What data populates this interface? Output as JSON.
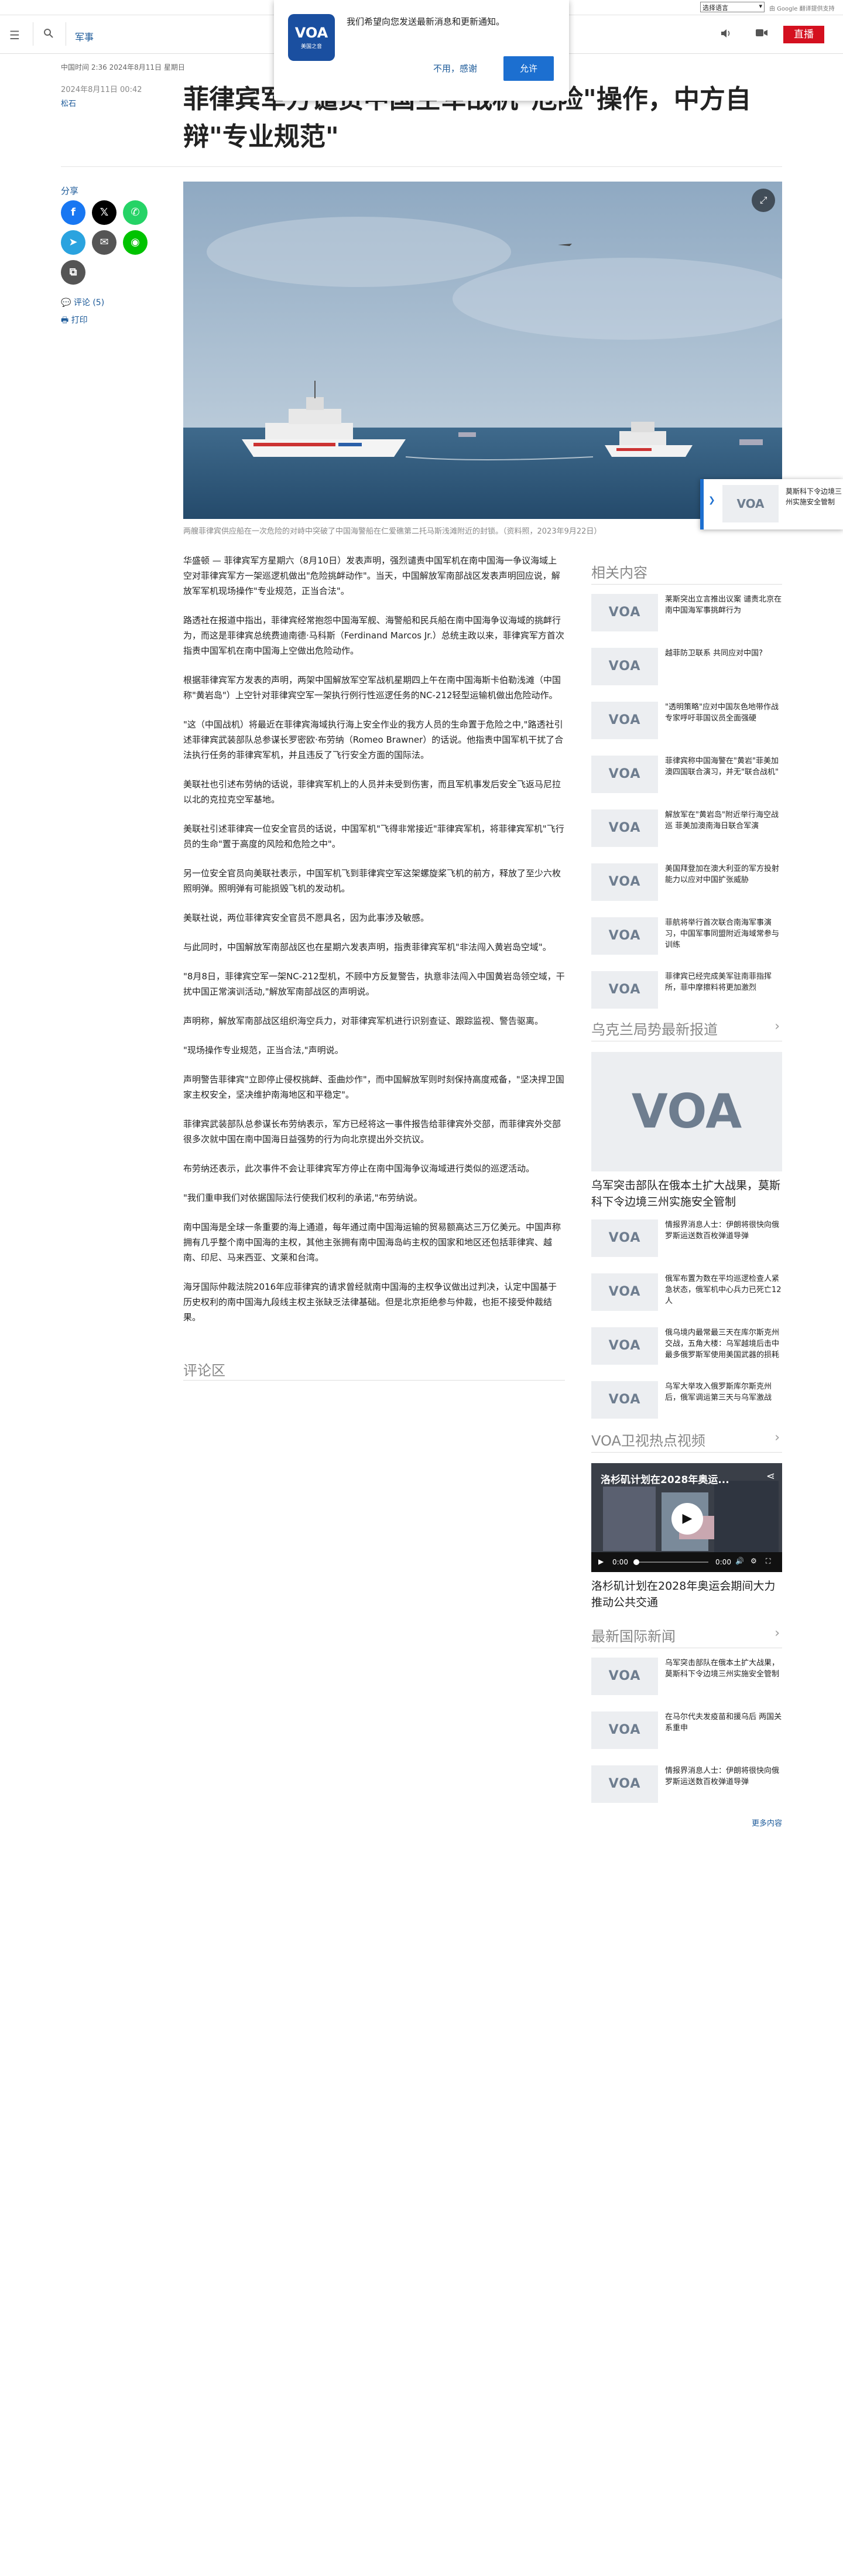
{
  "translate": {
    "select_label": "选择语言",
    "powered_by": "由 Google 翻译提供支持",
    "powered_google": "Google",
    "powered_translate": "翻译"
  },
  "header": {
    "section": "军事",
    "live_label": "直播"
  },
  "notification": {
    "message": "我们希望向您发送最新消息和更新通知。",
    "decline": "不用，感谢",
    "allow": "允许",
    "logo_sub": "美国之音"
  },
  "article_meta": {
    "dateline": "中国时间 2:36 2024年8月11日 星期日",
    "published": "2024年8月11日 00:42",
    "author": "松石"
  },
  "headline": "菲律宾军方谴责中国空军战机\"危险\"操作，中方自辩\"专业规范\"",
  "share": {
    "label": "分享",
    "comments": "评论 (5)",
    "print": "打印"
  },
  "photo": {
    "caption": "两艘菲律宾供应船在一次危险的对峙中突破了中国海警船在仁爱礁第二托马斯浅滩附近的封锁。（资料照，2023年9月22日）"
  },
  "article": {
    "paragraphs": [
      "华盛顿 — 菲律宾军方星期六（8月10日）发表声明，强烈谴责中国军机在南中国海一争议海域上空对菲律宾军方一架巡逻机做出\"危险挑衅动作\"。当天，中国解放军南部战区发表声明回应说，解放军军机现场操作\"专业规范，正当合法\"。",
      "路透社在报道中指出，菲律宾经常抱怨中国海军舰、海警船和民兵船在南中国海争议海域的挑衅行为，而这是菲律宾总统费迪南德·马科斯（Ferdinand Marcos Jr.）总统主政以来，菲律宾军方首次指责中国军机在南中国海上空做出危险动作。",
      "根据菲律宾军方发表的声明，两架中国解放军空军战机星期四上午在南中国海斯卡伯勒浅滩（中国称\"黄岩岛\"）上空针对菲律宾空军一架执行例行性巡逻任务的NC-212轻型运输机做出危险动作。",
      "\"这（中国战机）将最近在菲律宾海域执行海上安全作业的我方人员的生命置于危险之中,\"路透社引述菲律宾武装部队总参谋长罗密欧·布劳纳（Romeo Brawner）的话说。他指责中国军机干扰了合法执行任务的菲律宾军机，并且违反了飞行安全方面的国际法。",
      "美联社也引述布劳纳的话说，菲律宾军机上的人员并未受到伤害，而且军机事发后安全飞返马尼拉以北的克拉克空军基地。",
      "美联社引述菲律宾一位安全官员的话说，中国军机\"飞得非常接近\"菲律宾军机，将菲律宾军机\"飞行员的生命\"置于高度的风险和危险之中\"。",
      "另一位安全官员向美联社表示，中国军机飞到菲律宾空军这架螺旋桨飞机的前方，释放了至少六枚照明弹。照明弹有可能损毁飞机的发动机。",
      "美联社说，两位菲律宾安全官员不愿具名，因为此事涉及敏感。",
      "与此同时，中国解放军南部战区也在星期六发表声明，指责菲律宾军机\"非法闯入黄岩岛空域\"。",
      "\"8月8日，菲律宾空军一架NC-212型机，不顾中方反复警告，执意非法闯入中国黄岩岛领空域，干扰中国正常演训活动,\"解放军南部战区的声明说。",
      "声明称，解放军南部战区组织海空兵力，对菲律宾军机进行识别查证、跟踪监视、警告驱离。",
      "\"现场操作专业规范，正当合法,\"声明说。",
      "声明警告菲律宾\"立即停止侵权挑衅、歪曲炒作\"，而中国解放军则时刻保持高度戒备，\"坚决捍卫国家主权安全，坚决维护南海地区和平稳定\"。",
      "菲律宾武装部队总参谋长布劳纳表示，军方已经将这一事件报告给菲律宾外交部，而菲律宾外交部很多次就中国在南中国海日益强势的行为向北京提出外交抗议。",
      "布劳纳还表示，此次事件不会让菲律宾军方停止在南中国海争议海域进行类似的巡逻活动。",
      "\"我们重申我们对依据国际法行使我们权利的承诺,\"布劳纳说。",
      "南中国海是全球一条重要的海上通道，每年通过南中国海运输的贸易额高达三万亿美元。中国声称拥有几乎整个南中国海的主权，其他主张拥有南中国海岛屿主权的国家和地区还包括菲律宾、越南、印尼、马来西亚、文莱和台湾。",
      "海牙国际仲裁法院2016年应菲律宾的请求曾经就南中国海的主权争议做出过判决，认定中国基于历史权利的南中国海九段线主权主张缺乏法律基础。但是北京拒绝参与仲裁，也拒不接受仲裁结果。"
    ]
  },
  "comments_heading": "评论区",
  "related": {
    "heading": "相关内容",
    "items": [
      "莱斯突出立言推出议案 谴责北京在南中国海军事挑衅行为",
      "越菲防卫联系 共同应对中国?",
      "\"透明策略\"应对中国灰色地带作战 专家呼吁菲国议员全面强硬",
      "菲律宾称中国海警在\"黄岩\"菲美加澳四国联合演习，并无\"联合战机\"",
      "解放军在\"黄岩岛\"附近举行海空战巡 菲美加澳南海日联合军演",
      "美国拜登加在澳大利亚的军方投射能力以应对中国扩张威胁",
      "菲航将举行首次联合南海军事演习，中国军事同盟附近海域常参与训练",
      "菲律宾已经完成美军驻南菲指挥所，菲中摩擦料将更加激烈"
    ]
  },
  "ukraine": {
    "heading": "乌克兰局势最新报道",
    "feature_title": "乌军突击部队在俄本土扩大战果，莫斯科下令边境三州实施安全管制",
    "items": [
      "情报界消息人士：伊朗将很快向俄罗斯运送数百枚弹道导弹",
      "俄军布置为数在平均巡逻检查人紧急状态，俄军机中心兵力已死亡12人",
      "俄乌境内最常最三天在库尔斯克州交战，五角大楼：乌军越境后击中最多俄罗斯军使用美国武器的损耗",
      "乌军大举攻入俄罗斯库尔斯克州后，俄军调运第三天与乌军激战"
    ]
  },
  "video": {
    "heading": "VOA卫视热点视频",
    "player_title": "洛杉矶计划在2028年奥运...",
    "time_now": "0:00",
    "time_total": "0:00",
    "caption": "洛杉矶计划在2028年奥运会期间大力推动公共交通"
  },
  "latest": {
    "heading": "最新国际新闻",
    "items": [
      "乌军突击部队在俄本土扩大战果，莫斯科下令边境三州实施安全管制",
      "在马尔代夫发疫苗和援乌后 两国关系重申",
      "情报界消息人士：伊朗将很快向俄罗斯运送数百枚弹道导弹"
    ],
    "more": "更多内容"
  },
  "float_card": {
    "text": "莫斯科下令边境三州实施安全管制"
  },
  "logo_text": "VOA",
  "colors": {
    "link": "#1c5a99",
    "live": "#d4101f",
    "allow_button": "#1c6fd0",
    "facebook": "#1877f2",
    "x": "#000000",
    "whatsapp": "#25d366",
    "telegram": "#2aa3df",
    "email": "#555555",
    "line": "#00c300",
    "copy": "#555555"
  },
  "icons": {
    "menu": "hamburger-icon",
    "search": "search-icon",
    "audio": "speaker-icon",
    "video": "camera-icon",
    "expand": "expand-icon",
    "comments": "comment-icon",
    "print": "printer-icon",
    "chevron": "chevron-right-icon"
  }
}
